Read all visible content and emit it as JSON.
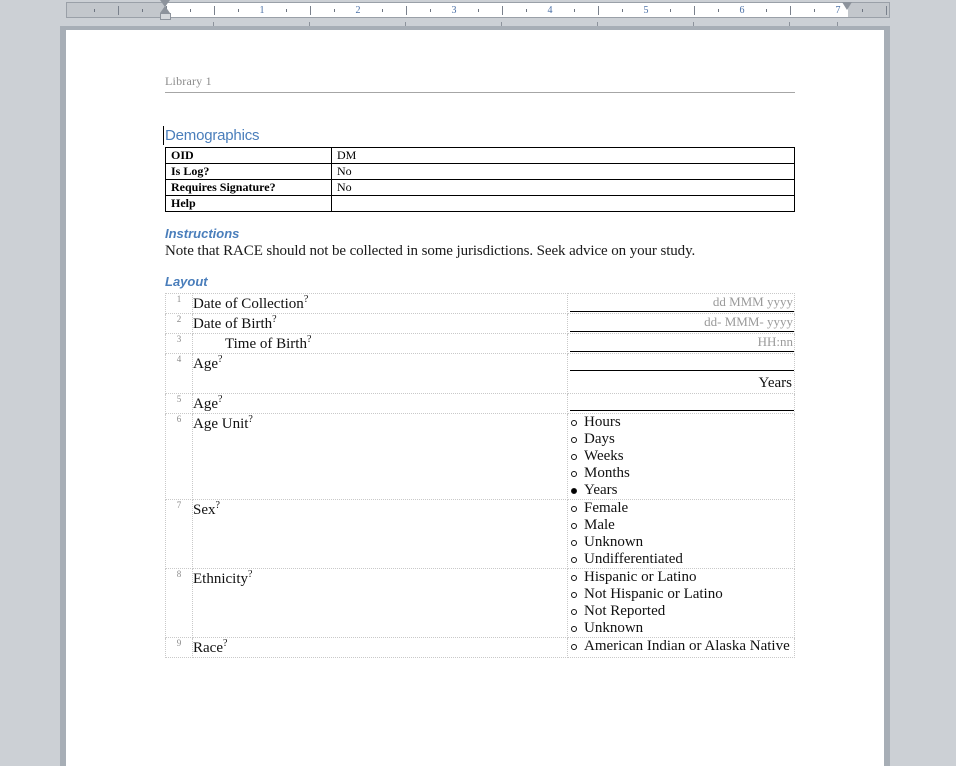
{
  "ruler": {
    "numbers": [
      "1",
      "2",
      "3",
      "4",
      "5",
      "6",
      "7"
    ],
    "left_indent_marker": "indent-marker",
    "right_indent_marker": "right-indent-marker"
  },
  "document": {
    "header_text": "Library 1",
    "form_title": "Demographics",
    "meta_table": {
      "rows": [
        {
          "key": "OID",
          "value": "DM"
        },
        {
          "key": "Is Log?",
          "value": "No"
        },
        {
          "key": "Requires Signature?",
          "value": "No"
        },
        {
          "key": "Help",
          "value": ""
        }
      ]
    },
    "instructions_heading": "Instructions",
    "instructions_text": "Note that RACE should not be collected in some jurisdictions. Seek advice on your study.",
    "layout_heading": "Layout",
    "layout_rows": [
      {
        "number": "1",
        "label": "Date of Collection",
        "help": "?",
        "type": "text",
        "format_hint": "dd MMM yyyy",
        "unit": ""
      },
      {
        "number": "2",
        "label": "Date of Birth",
        "help": "?",
        "type": "text",
        "format_hint": "dd- MMM- yyyy",
        "unit": ""
      },
      {
        "number": "3",
        "label": "Time of Birth",
        "help": "?",
        "type": "text",
        "format_hint": "HH:nn",
        "unit": ""
      },
      {
        "number": "4",
        "label": "Age",
        "help": "?",
        "type": "text",
        "format_hint": "",
        "unit": "Years"
      },
      {
        "number": "5",
        "label": "Age",
        "help": "?",
        "type": "text",
        "format_hint": "",
        "unit": ""
      },
      {
        "number": "6",
        "label": "Age Unit",
        "help": "?",
        "type": "radio",
        "options": [
          {
            "text": "Hours",
            "selected": false
          },
          {
            "text": "Days",
            "selected": false
          },
          {
            "text": "Weeks",
            "selected": false
          },
          {
            "text": "Months",
            "selected": false
          },
          {
            "text": "Years",
            "selected": true
          }
        ]
      },
      {
        "number": "7",
        "label": "Sex",
        "help": "?",
        "type": "radio",
        "options": [
          {
            "text": "Female",
            "selected": false
          },
          {
            "text": "Male",
            "selected": false
          },
          {
            "text": "Unknown",
            "selected": false
          },
          {
            "text": "Undifferentiated",
            "selected": false
          }
        ]
      },
      {
        "number": "8",
        "label": "Ethnicity",
        "help": "?",
        "type": "radio",
        "options": [
          {
            "text": "Hispanic or Latino",
            "selected": false
          },
          {
            "text": "Not Hispanic or Latino",
            "selected": false
          },
          {
            "text": "Not Reported",
            "selected": false
          },
          {
            "text": "Unknown",
            "selected": false
          }
        ]
      },
      {
        "number": "9",
        "label": "Race",
        "help": "?",
        "type": "radio",
        "options": [
          {
            "text": "American Indian or Alaska Native",
            "selected": false
          }
        ]
      }
    ]
  },
  "colors": {
    "heading_blue": "#4a7ebb",
    "header_gray": "#8c8c8c",
    "hint_gray": "#9a9a9a",
    "app_background": "#ccd0d5"
  }
}
